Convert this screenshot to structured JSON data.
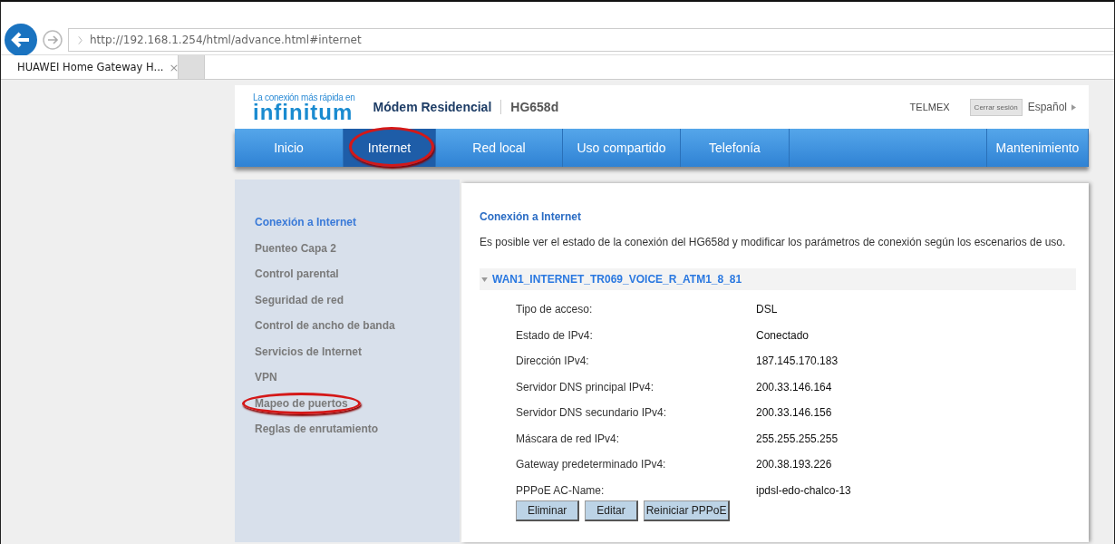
{
  "browser": {
    "url": "http://192.168.1.254/html/advance.html#internet",
    "tab_title": "HUAWEI Home Gateway H...",
    "tab_close": "×"
  },
  "header": {
    "tagline": "La conexión más rápida en",
    "logo": "infinitum",
    "product": "Módem Residencial",
    "model": "HG658d",
    "operator": "TELMEX",
    "logout": "Cerrar sesión",
    "language": "Español"
  },
  "nav": [
    {
      "label": "Inicio",
      "selected": false,
      "circled": false
    },
    {
      "label": "Internet",
      "selected": true,
      "circled": true
    },
    {
      "label": "Red local",
      "selected": false,
      "circled": false
    },
    {
      "label": "Uso compartido",
      "selected": false,
      "circled": false
    },
    {
      "label": "Telefonía",
      "selected": false,
      "circled": false
    },
    {
      "label": "Mantenimiento",
      "selected": false,
      "circled": false
    }
  ],
  "sidebar": {
    "items": [
      {
        "label": "Conexión a Internet",
        "selected": true,
        "circled": false
      },
      {
        "label": "Puenteo Capa 2",
        "selected": false,
        "circled": false
      },
      {
        "label": "Control parental",
        "selected": false,
        "circled": false
      },
      {
        "label": "Seguridad de red",
        "selected": false,
        "circled": false
      },
      {
        "label": "Control de ancho de banda",
        "selected": false,
        "circled": false
      },
      {
        "label": "Servicios de Internet",
        "selected": false,
        "circled": false
      },
      {
        "label": "VPN",
        "selected": false,
        "circled": false
      },
      {
        "label": "Mapeo de puertos",
        "selected": false,
        "circled": true
      },
      {
        "label": "Reglas de enrutamiento",
        "selected": false,
        "circled": false
      }
    ]
  },
  "main": {
    "title": "Conexión a Internet",
    "description": "Es posible ver el estado de la conexión del HG658d y modificar los parámetros de conexión según los escenarios de uso.",
    "connection": {
      "name": "WAN1_INTERNET_TR069_VOICE_R_ATM1_8_81",
      "expanded": true,
      "fields": [
        {
          "label": "Tipo de acceso:",
          "value": "DSL"
        },
        {
          "label": "Estado de IPv4:",
          "value": "Conectado"
        },
        {
          "label": "Dirección IPv4:",
          "value": "187.145.170.183"
        },
        {
          "label": "Servidor DNS principal IPv4:",
          "value": "200.33.146.164"
        },
        {
          "label": "Servidor DNS secundario IPv4:",
          "value": "200.33.146.156"
        },
        {
          "label": "Máscara de red IPv4:",
          "value": "255.255.255.255"
        },
        {
          "label": "Gateway predeterminado IPv4:",
          "value": "200.38.193.226"
        },
        {
          "label": "PPPoE AC-Name:",
          "value": "ipdsl-edo-chalco-13"
        }
      ],
      "buttons": [
        "Eliminar",
        "Editar",
        "Reiniciar PPPoE"
      ]
    }
  }
}
